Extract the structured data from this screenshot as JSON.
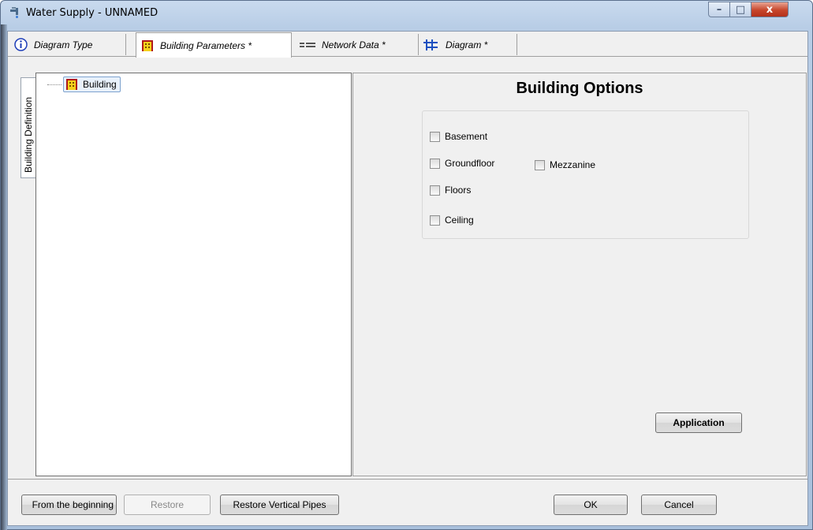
{
  "window": {
    "title": "Water Supply - UNNAMED",
    "controls": {
      "minimize": "–",
      "maximize": "□",
      "close": "x"
    }
  },
  "tabs": [
    {
      "label": "Diagram Type",
      "icon": "info-icon"
    },
    {
      "label": "Building Parameters *",
      "icon": "building-icon",
      "active": true
    },
    {
      "label": "Network Data *",
      "icon": "network-icon"
    },
    {
      "label": "Diagram *",
      "icon": "diagram-icon"
    }
  ],
  "side_tab": {
    "label": "Building Definition"
  },
  "tree": {
    "root": {
      "label": "Building",
      "icon": "building-icon",
      "selected": true
    }
  },
  "options": {
    "title": "Building Options",
    "checkboxes": [
      {
        "label": "Basement",
        "checked": false
      },
      {
        "label": "Groundfloor",
        "checked": false
      },
      {
        "label": "Mezzanine",
        "checked": false
      },
      {
        "label": "Floors",
        "checked": false
      },
      {
        "label": "Ceiling",
        "checked": false
      }
    ],
    "apply_button": "Application"
  },
  "footer": {
    "from_beginning": "From the beginning",
    "restore": "Restore",
    "restore_vertical_pipes": "Restore Vertical Pipes",
    "ok": "OK",
    "cancel": "Cancel"
  },
  "colors": {
    "building_icon_fill": "#f5d21c",
    "building_icon_border": "#b11a1a",
    "info_icon": "#1f3fb8",
    "close_button": "#c7462b"
  }
}
